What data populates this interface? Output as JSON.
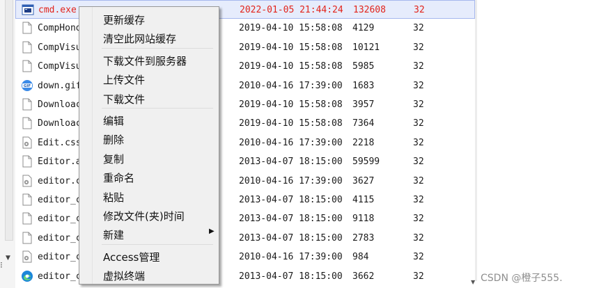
{
  "files": [
    {
      "name": "cmd.exe",
      "date": "2022-01-05 21:44:24",
      "size": "132608",
      "perm": "32",
      "icon": "exe-icon",
      "selected": true,
      "highlight": "red"
    },
    {
      "name": "CompHono",
      "date": "2019-04-10 15:58:08",
      "size": "4129",
      "perm": "32",
      "icon": "file-icon"
    },
    {
      "name": "CompVisu",
      "date": "2019-04-10 15:58:08",
      "size": "10121",
      "perm": "32",
      "icon": "file-icon"
    },
    {
      "name": "CompVisu",
      "date": "2019-04-10 15:58:08",
      "size": "5985",
      "perm": "32",
      "icon": "file-icon"
    },
    {
      "name": "down.gif",
      "date": "2010-04-16 17:39:00",
      "size": "1683",
      "perm": "32",
      "icon": "gif-icon"
    },
    {
      "name": "Downloac",
      "date": "2019-04-10 15:58:08",
      "size": "3957",
      "perm": "32",
      "icon": "file-icon"
    },
    {
      "name": "Downloac",
      "date": "2019-04-10 15:58:08",
      "size": "7364",
      "perm": "32",
      "icon": "file-icon"
    },
    {
      "name": "Edit.css",
      "date": "2010-04-16 17:39:00",
      "size": "2218",
      "perm": "32",
      "icon": "gear-file-icon"
    },
    {
      "name": "Editor.a",
      "date": "2013-04-07 18:15:00",
      "size": "59599",
      "perm": "32",
      "icon": "file-icon"
    },
    {
      "name": "editor.c",
      "date": "2010-04-16 17:39:00",
      "size": "3627",
      "perm": "32",
      "icon": "gear-file-icon"
    },
    {
      "name": "editor_c",
      "date": "2013-04-07 18:15:00",
      "size": "4115",
      "perm": "32",
      "icon": "file-icon"
    },
    {
      "name": "editor_c",
      "date": "2013-04-07 18:15:00",
      "size": "9118",
      "perm": "32",
      "icon": "file-icon"
    },
    {
      "name": "editor_c",
      "date": "2013-04-07 18:15:00",
      "size": "2783",
      "perm": "32",
      "icon": "file-icon"
    },
    {
      "name": "editor_c",
      "date": "2010-04-16 17:39:00",
      "size": "984",
      "perm": "32",
      "icon": "gear-file-icon"
    },
    {
      "name": "editor_c",
      "date": "2013-04-07 18:15:00",
      "size": "3662",
      "perm": "32",
      "icon": "edge-icon"
    }
  ],
  "menu": {
    "groups": [
      [
        "更新缓存",
        "清空此网站缓存"
      ],
      [
        "下载文件到服务器",
        "上传文件",
        "下载文件"
      ],
      [
        "编辑",
        "删除",
        "复制",
        "重命名",
        "粘贴",
        "修改文件(夹)时间",
        "新建"
      ],
      [
        "Access管理",
        "虚拟终端"
      ]
    ],
    "submenu_arrow": "▶"
  },
  "scroll": {
    "down_arrow": "▼",
    "left_glyph": "⁝"
  },
  "watermark": "CSDN @橙子555.",
  "colors": {
    "red": "#e2231a",
    "selection_bg": "#e6ecfc",
    "menu_bg": "#f0f0f0"
  }
}
